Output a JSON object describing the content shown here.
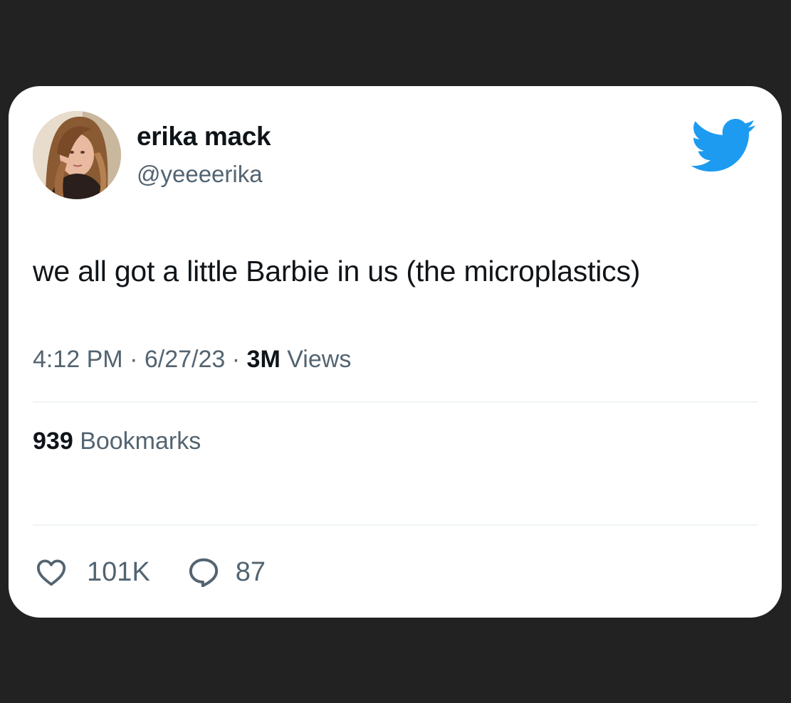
{
  "author": {
    "display_name": "erika mack",
    "handle": "@yeeeerika",
    "avatar_icon": "profile-photo"
  },
  "brand": {
    "icon": "twitter-bird-icon",
    "color": "#1d9bf0"
  },
  "tweet": {
    "text": "we all got a little Barbie in us (the microplastics)"
  },
  "meta": {
    "time": "4:12 PM",
    "separator": "·",
    "date": "6/27/23",
    "views_count": "3M",
    "views_label": "Views"
  },
  "bookmarks": {
    "count": "939",
    "label": "Bookmarks"
  },
  "actions": {
    "like_icon": "heart-icon",
    "like_count": "101K",
    "reply_icon": "reply-bubble-icon",
    "reply_count": "87"
  },
  "colors": {
    "background": "#222222",
    "card": "#ffffff",
    "primary_text": "#0f1419",
    "secondary_text": "#536471",
    "divider": "#eff3f4"
  }
}
